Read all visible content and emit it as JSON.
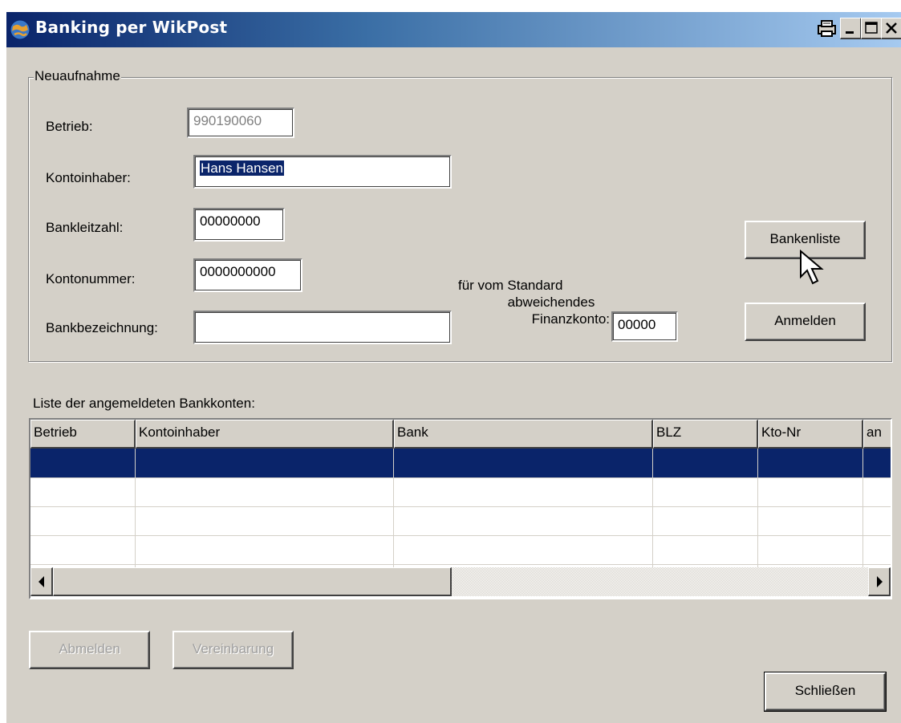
{
  "window": {
    "title": "Banking per WikPost",
    "icons": [
      "app-globe-icon",
      "print-icon",
      "minimize-icon",
      "maximize-icon",
      "close-icon"
    ]
  },
  "group": {
    "label": "Neuaufnahme",
    "betrieb_label": "Betrieb:",
    "betrieb_value": "990190060",
    "kontoinhaber_label": "Kontoinhaber:",
    "kontoinhaber_value": "Hans Hansen",
    "bankleitzahl_label": "Bankleitzahl:",
    "bankleitzahl_value": "00000000",
    "kontonummer_label": "Kontonummer:",
    "kontonummer_value": "0000000000",
    "bankbezeichnung_label": "Bankbezeichnung:",
    "bankbezeichnung_value": "",
    "finanzkonto_line1": "für vom Standard",
    "finanzkonto_line2": "abweichendes",
    "finanzkonto_line3": "Finanzkonto:",
    "finanzkonto_value": "00000",
    "bankenliste_button": "Bankenliste",
    "anmelden_button": "Anmelden"
  },
  "list": {
    "label": "Liste der angemeldeten Bankkonten:",
    "columns": [
      "Betrieb",
      "Kontoinhaber",
      "Bank",
      "BLZ",
      "Kto-Nr",
      "an"
    ],
    "rows": [
      [
        "",
        "",
        "",
        "",
        "",
        ""
      ],
      [
        "",
        "",
        "",
        "",
        "",
        ""
      ],
      [
        "",
        "",
        "",
        "",
        "",
        ""
      ],
      [
        "",
        "",
        "",
        "",
        "",
        ""
      ]
    ],
    "selected_row": 0
  },
  "footer": {
    "abmelden_button": "Abmelden",
    "vereinbarung_button": "Vereinbarung",
    "schliessen_button": "Schließen"
  },
  "colors": {
    "face": "#d4d0c8",
    "selection": "#0a246a",
    "title_start": "#0a246a",
    "title_end": "#a6caf0"
  }
}
